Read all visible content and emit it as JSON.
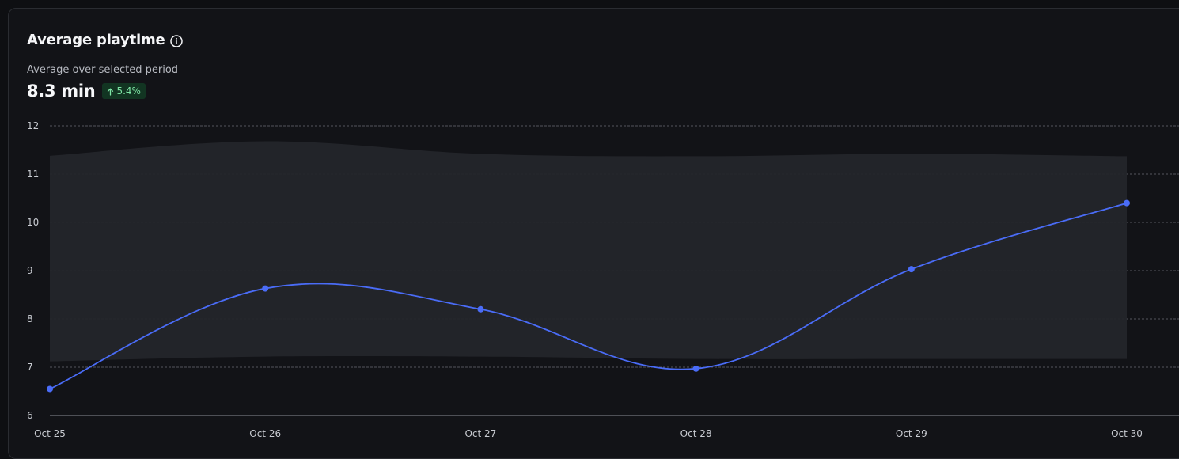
{
  "card": {
    "title": "Average playtime",
    "subtitle": "Average over selected period",
    "metric_value": "8.3 min",
    "delta": "5.4%",
    "delta_direction": "up",
    "info_icon": "info-circle-icon",
    "delta_icon": "arrow-up-icon"
  },
  "colors": {
    "background": "#0e0f12",
    "card": "#121317",
    "line": "#4a6cf7",
    "band": "#24252a",
    "badge_bg": "#123522",
    "badge_text": "#7ee5a5",
    "grid": "#6b6e75"
  },
  "chart_data": {
    "type": "line",
    "categories": [
      "Oct 25",
      "Oct 26",
      "Oct 27",
      "Oct 28",
      "Oct 29",
      "Oct 30"
    ],
    "series": [
      {
        "values": [
          6.55,
          8.63,
          8.2,
          6.97,
          9.03,
          10.4
        ]
      }
    ],
    "band": {
      "upper": [
        11.38,
        11.68,
        11.42,
        11.37,
        11.42,
        11.37
      ],
      "lower": [
        7.12,
        7.22,
        7.22,
        7.17,
        7.17,
        7.17
      ]
    },
    "y_ticks": [
      6,
      7,
      8,
      9,
      10,
      11,
      12
    ],
    "ylim": [
      6,
      12
    ],
    "grid": true,
    "title": "",
    "xlabel": "",
    "ylabel": ""
  }
}
